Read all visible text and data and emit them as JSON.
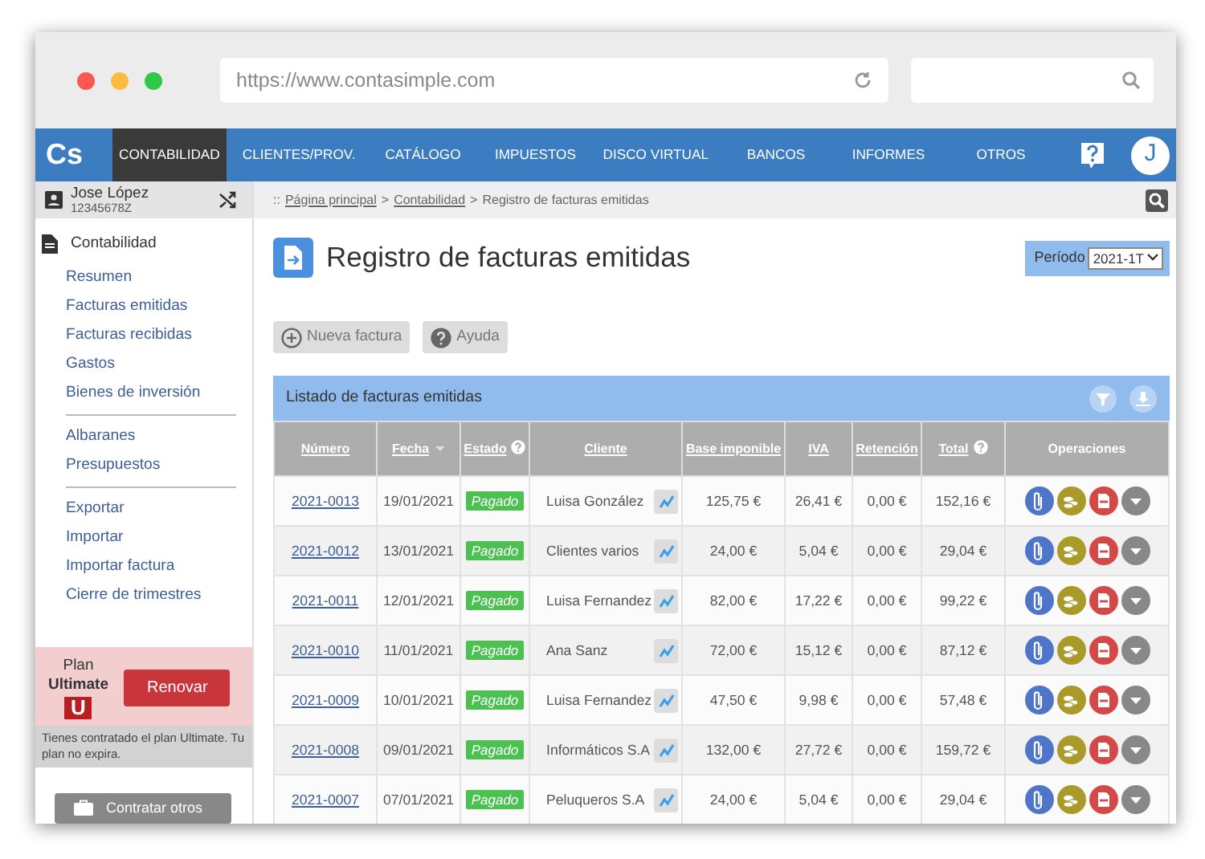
{
  "browser": {
    "url": "https://www.contasimple.com"
  },
  "navbar": {
    "logo": "Cs",
    "avatar": "J",
    "items": [
      {
        "label": "CONTABILIDAD",
        "selected": true
      },
      {
        "label": "CLIENTES/PROV.",
        "selected": false
      },
      {
        "label": "CATÁLOGO",
        "selected": false
      },
      {
        "label": "IMPUESTOS",
        "selected": false
      },
      {
        "label": "DISCO VIRTUAL",
        "selected": false
      },
      {
        "label": "BANCOS",
        "selected": false
      },
      {
        "label": "INFORMES",
        "selected": false
      },
      {
        "label": "OTROS",
        "selected": false
      }
    ]
  },
  "user": {
    "name": "Jose López",
    "id": "12345678Z"
  },
  "breadcrumb": [
    {
      "kind": "mark",
      "text": "::"
    },
    {
      "kind": "link",
      "text": "Página principal"
    },
    {
      "kind": "sep",
      "text": ">"
    },
    {
      "kind": "link",
      "text": "Contabilidad"
    },
    {
      "kind": "sep",
      "text": ">"
    },
    {
      "kind": "current",
      "text": "Registro de facturas emitidas"
    }
  ],
  "sidebar": {
    "section": "Contabilidad",
    "groups": [
      [
        "Resumen",
        "Facturas emitidas",
        "Facturas recibidas",
        "Gastos",
        "Bienes de inversión"
      ],
      [
        "Albaranes",
        "Presupuestos"
      ],
      [
        "Exportar",
        "Importar",
        "Importar factura",
        "Cierre de trimestres"
      ]
    ],
    "plan": {
      "label": "Plan",
      "name": "Ultimate",
      "badge": "U",
      "button": "Renovar",
      "note": "Tienes contratado el plan Ultimate. Tu plan no expira."
    },
    "contract_button": "Contratar otros"
  },
  "page": {
    "title": "Registro de facturas emitidas",
    "period_label": "Período",
    "period_value": "2021-1T",
    "buttons": [
      {
        "kind": "add",
        "label": "Nueva factura"
      },
      {
        "kind": "help",
        "label": "Ayuda"
      }
    ],
    "panel_title": "Listado de facturas emitidas"
  },
  "table": {
    "columns": [
      {
        "label": "Número",
        "link": true,
        "sorted": false,
        "help": false
      },
      {
        "label": "Fecha",
        "link": true,
        "sorted": true,
        "help": false
      },
      {
        "label": "Estado",
        "link": true,
        "sorted": false,
        "help": true
      },
      {
        "label": "Cliente",
        "link": true,
        "sorted": false,
        "help": false
      },
      {
        "label": "Base imponible",
        "link": true,
        "sorted": false,
        "help": false
      },
      {
        "label": "IVA",
        "link": true,
        "sorted": false,
        "help": false
      },
      {
        "label": "Retención",
        "link": true,
        "sorted": false,
        "help": false
      },
      {
        "label": "Total",
        "link": true,
        "sorted": false,
        "help": true
      },
      {
        "label": "Operaciones",
        "link": false,
        "sorted": false,
        "help": false
      }
    ],
    "rows": [
      {
        "number": "2021-0013",
        "date": "19/01/2021",
        "status": "Pagado",
        "client": "Luisa González",
        "base": "125,75 €",
        "iva": "26,41 €",
        "retention": "0,00 €",
        "total": "152,16 €"
      },
      {
        "number": "2021-0012",
        "date": "13/01/2021",
        "status": "Pagado",
        "client": "Clientes varios",
        "base": "24,00 €",
        "iva": "5,04 €",
        "retention": "0,00 €",
        "total": "29,04 €"
      },
      {
        "number": "2021-0011",
        "date": "12/01/2021",
        "status": "Pagado",
        "client": "Luisa Fernandez",
        "base": "82,00 €",
        "iva": "17,22 €",
        "retention": "0,00 €",
        "total": "99,22 €"
      },
      {
        "number": "2021-0010",
        "date": "11/01/2021",
        "status": "Pagado",
        "client": "Ana Sanz",
        "base": "72,00 €",
        "iva": "15,12 €",
        "retention": "0,00 €",
        "total": "87,12 €"
      },
      {
        "number": "2021-0009",
        "date": "10/01/2021",
        "status": "Pagado",
        "client": "Luisa Fernandez",
        "base": "47,50 €",
        "iva": "9,98 €",
        "retention": "0,00 €",
        "total": "57,48 €"
      },
      {
        "number": "2021-0008",
        "date": "09/01/2021",
        "status": "Pagado",
        "client": "Informáticos S.A",
        "base": "132,00 €",
        "iva": "27,72 €",
        "retention": "0,00 €",
        "total": "159,72 €"
      },
      {
        "number": "2021-0007",
        "date": "07/01/2021",
        "status": "Pagado",
        "client": "Peluqueros S.A",
        "base": "24,00 €",
        "iva": "5,04 €",
        "retention": "0,00 €",
        "total": "29,04 €"
      }
    ]
  }
}
